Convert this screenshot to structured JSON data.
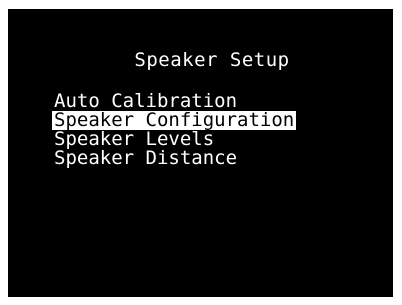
{
  "screen": {
    "title": "Speaker Setup",
    "selected_index": 1,
    "menu_items": [
      {
        "label": "Auto Calibration"
      },
      {
        "label": "Speaker Configuration"
      },
      {
        "label": "Speaker Levels"
      },
      {
        "label": "Speaker Distance"
      }
    ]
  },
  "colors": {
    "background": "#000000",
    "text": "#ffffff",
    "highlight": "#ffffff",
    "highlight_text": "#000000"
  }
}
